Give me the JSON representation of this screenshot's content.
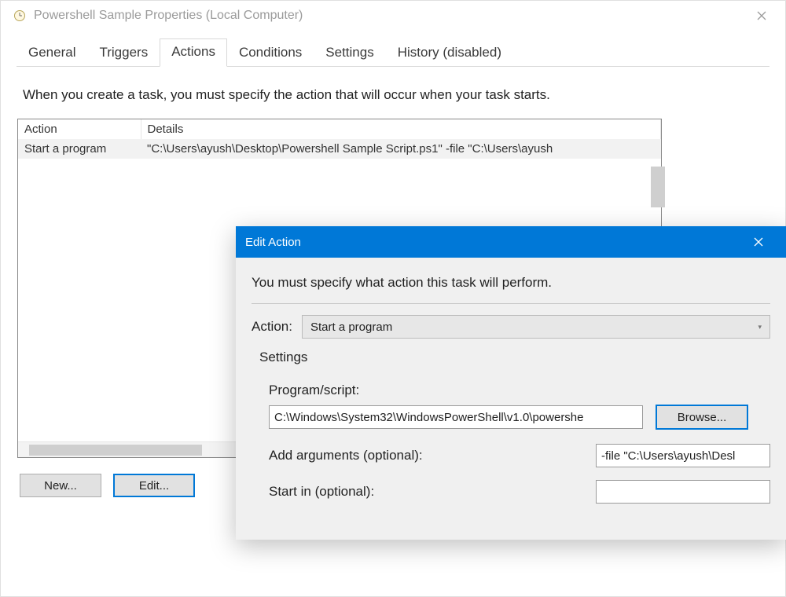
{
  "parent": {
    "title": "Powershell Sample Properties (Local Computer)",
    "tabs": [
      "General",
      "Triggers",
      "Actions",
      "Conditions",
      "Settings",
      "History (disabled)"
    ],
    "active_tab_index": 2,
    "description": "When you create a task, you must specify the action that will occur when your task starts.",
    "table": {
      "columns": [
        "Action",
        "Details"
      ],
      "rows": [
        {
          "action": "Start a program",
          "details": "\"C:\\Users\\ayush\\Desktop\\Powershell Sample Script.ps1\" -file \"C:\\Users\\ayush"
        }
      ]
    },
    "buttons": {
      "new": "New...",
      "edit": "Edit..."
    }
  },
  "edit": {
    "title": "Edit Action",
    "description": "You must specify what action this task will perform.",
    "action_label": "Action:",
    "action_value": "Start a program",
    "settings_heading": "Settings",
    "program_label": "Program/script:",
    "program_value": "C:\\Windows\\System32\\WindowsPowerShell\\v1.0\\powershe",
    "browse_label": "Browse...",
    "arguments_label": "Add arguments (optional):",
    "arguments_value": "-file \"C:\\Users\\ayush\\Desl",
    "startin_label": "Start in (optional):",
    "startin_value": ""
  }
}
